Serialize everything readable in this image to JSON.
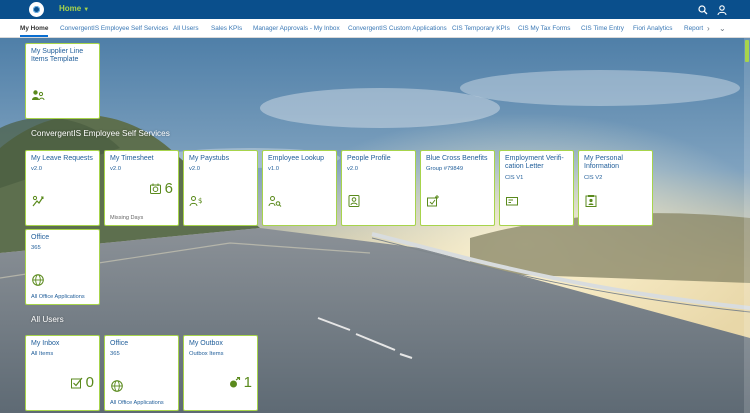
{
  "shell": {
    "title": "Home",
    "logo_icon": "company-logo",
    "icons": [
      "search-icon",
      "user-icon"
    ]
  },
  "tabs": [
    "My Home",
    "ConvergentIS Employee Self Services",
    "All Users",
    "Sales KPIs",
    "Manager Approvals - My Inbox",
    "ConvergentIS Custom Applications",
    "CIS Temporary KPIs",
    "CIS My Tax Forms",
    "CIS Time Entry",
    "Fiori Analytics",
    "Report"
  ],
  "top_tile": {
    "title": "My Supplier Line Items Template",
    "icon": "people-icon"
  },
  "sections": {
    "ess": "ConvergentIS Employee Self Services",
    "all_users": "All Users"
  },
  "ess_tiles": [
    {
      "title": "My Leave Requests",
      "subtitle": "v2.0",
      "icon": "leave-request-icon"
    },
    {
      "title": "My Timesheet",
      "subtitle": "v2.0",
      "kpi": "6",
      "footer": "Missing Days",
      "icon": "timesheet-icon"
    },
    {
      "title": "My Paystubs",
      "subtitle": "v2.0",
      "icon": "paystub-icon"
    },
    {
      "title": "Employee Lookup",
      "subtitle": "v1.0",
      "icon": "employee-lookup-icon"
    },
    {
      "title": "People Profile",
      "subtitle": "v2.0",
      "icon": "profile-card-icon"
    },
    {
      "title": "Blue Cross Benefits",
      "subtitle": "Group #79849",
      "icon": "benefits-icon"
    },
    {
      "title": "Employment Verifi-cation Letter",
      "subtitle": "CIS V1",
      "icon": "letter-icon"
    },
    {
      "title": "My Personal Information",
      "subtitle": "CIS V2",
      "icon": "personal-info-icon"
    }
  ],
  "office_tile": {
    "title": "Office",
    "subtitle": "365",
    "footer": "All Office Applications",
    "icon": "globe-icon"
  },
  "user_tiles": [
    {
      "title": "My Inbox",
      "subtitle": "All Items",
      "kpi": "0",
      "icon": "inbox-check-icon"
    },
    {
      "title": "Office",
      "subtitle": "365",
      "footer": "All Office Applications",
      "icon": "globe-icon"
    },
    {
      "title": "My Outbox",
      "subtitle": "Outbox Items",
      "kpi": "1",
      "icon": "outbox-icon"
    }
  ],
  "colors": {
    "shell": "#0a4f8c",
    "accent": "#a7d44b",
    "tile_text": "#1f5d99",
    "icon": "#5a8a1c"
  }
}
